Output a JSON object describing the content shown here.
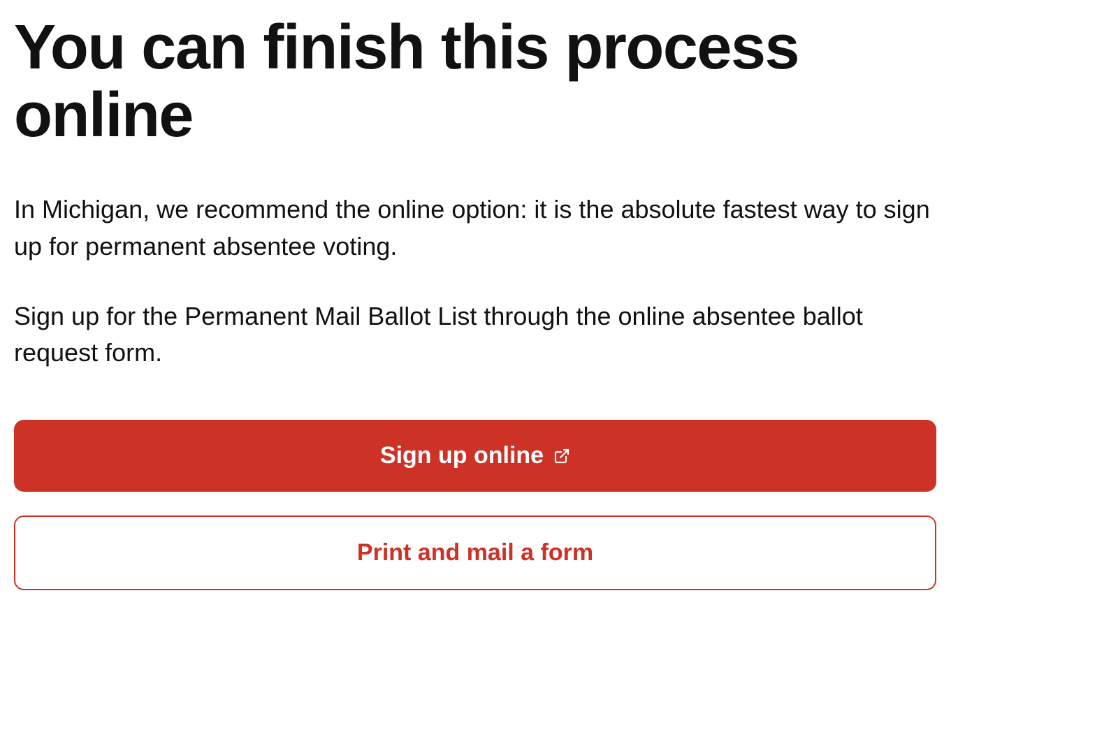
{
  "heading": "You can finish this process online",
  "paragraph1": "In Michigan, we recommend the online option: it is the absolute fastest way to sign up for permanent absentee voting.",
  "paragraph2": "Sign up for the Permanent Mail Ballot List through the online absentee ballot request form.",
  "buttons": {
    "primary_label": "Sign up online",
    "secondary_label": "Print and mail a form"
  },
  "colors": {
    "accent": "#CC3226"
  }
}
